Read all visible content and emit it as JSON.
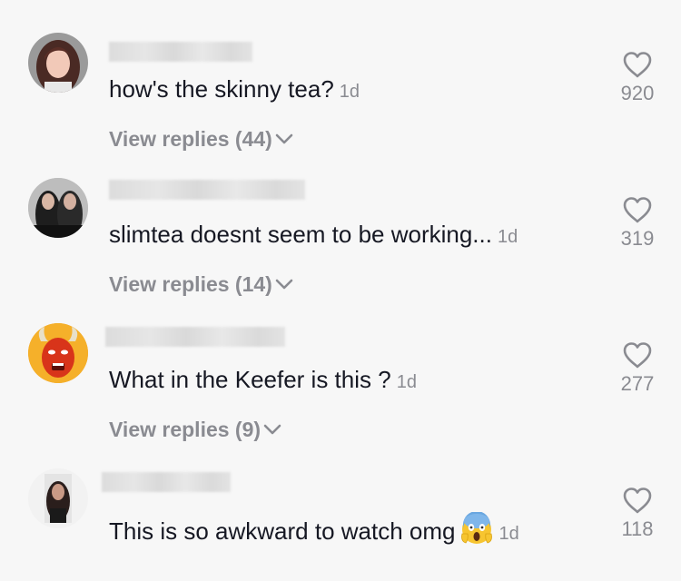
{
  "comments": [
    {
      "text": "how's the skinny tea?",
      "time": "1d",
      "replies_label": "View replies (44)",
      "likes": "920",
      "avatar": "avatar-woman-red-hair"
    },
    {
      "text": "slimtea doesnt seem to be working...",
      "time": "1d",
      "replies_label": "View replies (14)",
      "likes": "319",
      "avatar": "avatar-two-people"
    },
    {
      "text": "What in the Keefer is this ?",
      "time": "1d",
      "replies_label": "View replies (9)",
      "likes": "277",
      "avatar": "avatar-red-devil"
    },
    {
      "text": "This is so awkward to watch omg",
      "time": "1d",
      "emoji": "face-screaming-in-fear-emoji",
      "likes": "118",
      "avatar": "avatar-woman-dark-hair"
    }
  ],
  "colors": {
    "background": "#f7f7f7",
    "text": "#161823",
    "muted": "#8a8b91"
  },
  "icons": {
    "like": "heart-outline-icon",
    "expand": "chevron-down-icon"
  }
}
